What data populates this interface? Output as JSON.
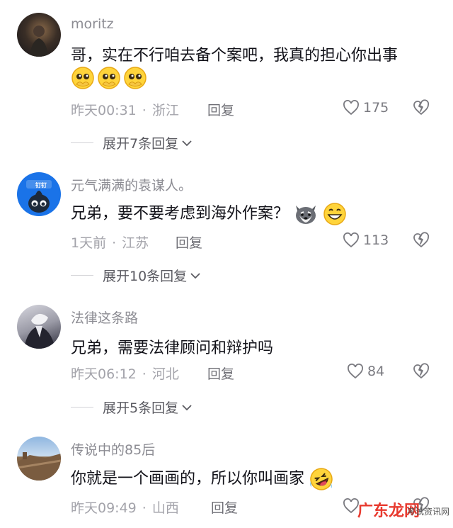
{
  "comments": [
    {
      "username": "moritz",
      "text": "哥，实在不行咱去备个案吧，我真的担心你出事",
      "emojis": [
        "pleading-face",
        "pleading-face",
        "pleading-face"
      ],
      "time": "昨天00:31",
      "location": "浙江",
      "reply_label": "回复",
      "likes": "175",
      "expand_label": "展开7条回复"
    },
    {
      "username": "元气满满的袁谋人。",
      "text": "兄弟，要不要考虑到海外作案？",
      "emojis": [
        "husky-dog",
        "grinning-face"
      ],
      "time": "1天前",
      "location": "江苏",
      "reply_label": "回复",
      "likes": "113",
      "expand_label": "展开10条回复",
      "avatar_badge": "钉钉"
    },
    {
      "username": "法律这条路",
      "text": "兄弟，需要法律顾问和辩护吗",
      "time": "昨天06:12",
      "location": "河北",
      "reply_label": "回复",
      "likes": "84",
      "expand_label": "展开5条回复"
    },
    {
      "username": "传说中的85后",
      "text": "你就是一个画画的，所以你叫画家",
      "emojis": [
        "rofl-face"
      ],
      "time": "昨天09:49",
      "location": "山西",
      "reply_label": "回复"
    }
  ],
  "watermark": {
    "text": "广东龙网",
    "sub": "考试资讯网"
  },
  "colors": {
    "username": "#8c8c93",
    "text": "#111118",
    "meta": "#a3a3aa",
    "icon": "#7a7a80",
    "watermark": "#e83a2f"
  }
}
